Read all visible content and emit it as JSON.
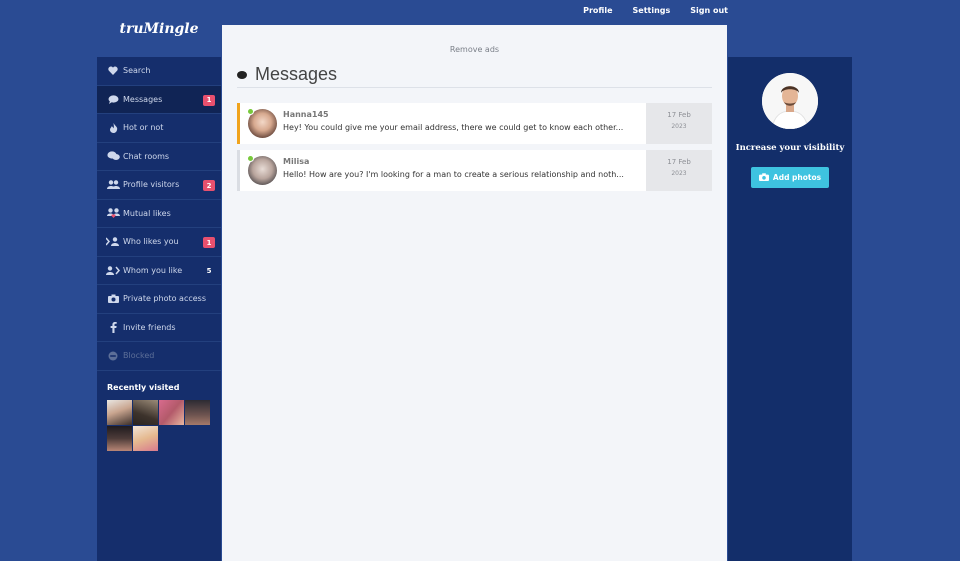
{
  "nav": {
    "profile": "Profile",
    "settings": "Settings",
    "signout": "Sign out"
  },
  "brand": {
    "logo": "truMingle"
  },
  "sidebar": {
    "items": [
      {
        "label": "Search",
        "icon": "heart-icon"
      },
      {
        "label": "Messages",
        "icon": "chat-icon",
        "badge": "1"
      },
      {
        "label": "Hot or not",
        "icon": "flame-icon"
      },
      {
        "label": "Chat rooms",
        "icon": "chat-rooms-icon"
      },
      {
        "label": "Profile visitors",
        "icon": "users-icon",
        "badge": "2"
      },
      {
        "label": "Mutual likes",
        "icon": "mutual-likes-icon"
      },
      {
        "label": "Who likes you",
        "icon": "who-likes-icon",
        "badge": "1"
      },
      {
        "label": "Whom you like",
        "icon": "whom-you-like-icon",
        "badge": "5"
      },
      {
        "label": "Private photo access",
        "icon": "camera-icon"
      },
      {
        "label": "Invite friends",
        "icon": "facebook-icon"
      },
      {
        "label": "Blocked",
        "icon": "blocked-icon"
      }
    ],
    "recent_title": "Recently visited"
  },
  "main": {
    "remove_ads": "Remove ads",
    "title": "Messages",
    "messages": [
      {
        "name": "Hanna145",
        "text": "Hey! You could give me your email address, there we could get to know each other...",
        "date": "17 Feb",
        "year": "2023"
      },
      {
        "name": "Milisa",
        "text": "Hello! How are you? I'm looking for a man to create a serious relationship and noth...",
        "date": "17 Feb",
        "year": "2023"
      }
    ]
  },
  "right": {
    "visibility": "Increase your visibility",
    "add_photos": "Add photos"
  },
  "colors": {
    "background": "#2a4b93",
    "sidebar": "#152e6c",
    "badge": "#e8506e",
    "accent": "#3ec3e0",
    "unread": "#f0a31c",
    "online": "#78c93b"
  }
}
